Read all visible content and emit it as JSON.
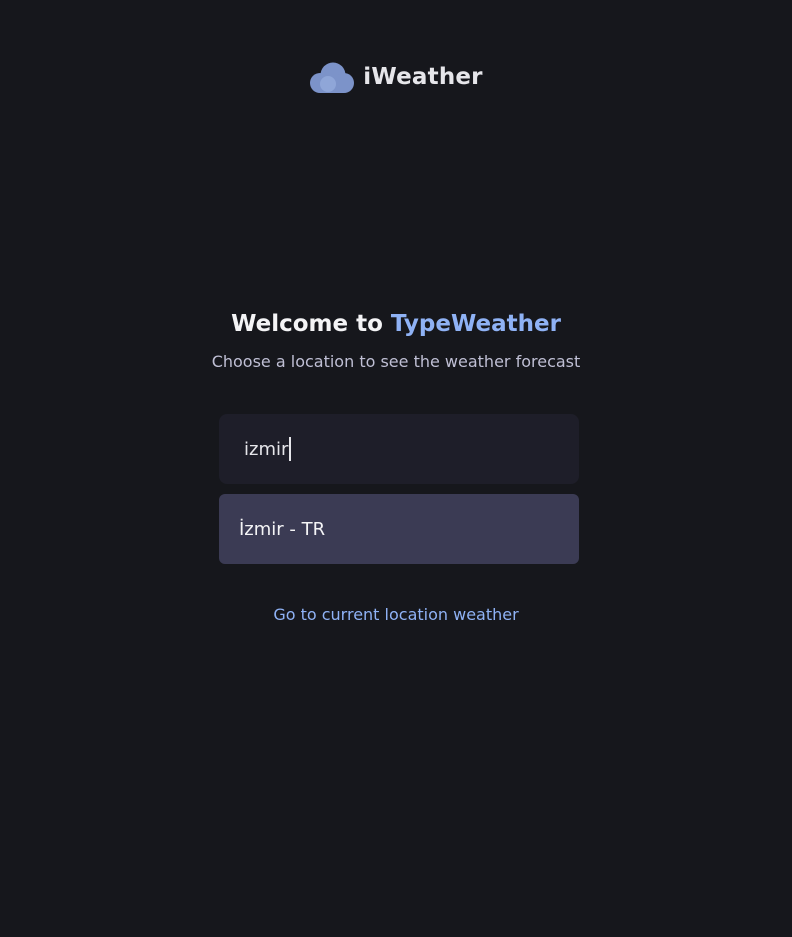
{
  "app": {
    "name": "iWeather"
  },
  "welcome": {
    "prefix": "Welcome to ",
    "brand": "TypeWeather",
    "subtitle": "Choose a location to see the weather forecast"
  },
  "search": {
    "value": "izmir"
  },
  "suggestions": [
    {
      "label": "İzmir - TR"
    }
  ],
  "actions": {
    "current_location_label": "Go to current location weather"
  },
  "colors": {
    "background": "#16171c",
    "accent": "#8fb2f5",
    "input_bg": "#1e1e29",
    "suggestion_bg": "#3b3b54"
  },
  "icons": {
    "logo": "cloud-icon"
  }
}
